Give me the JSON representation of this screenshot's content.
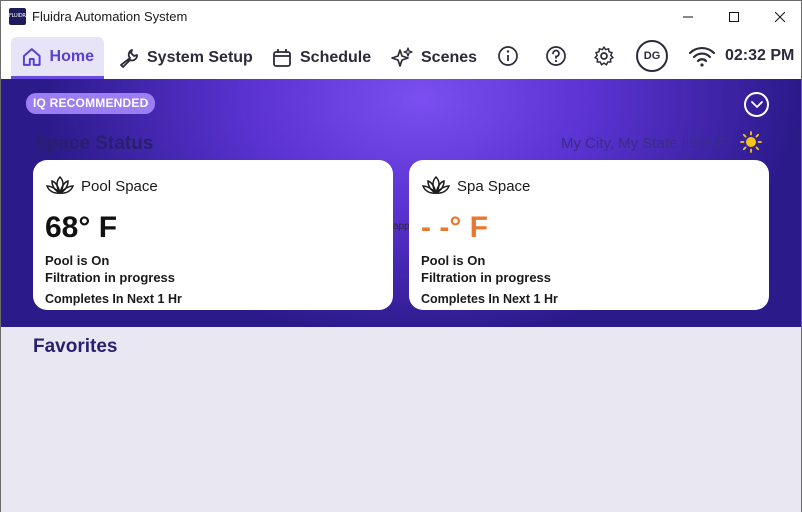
{
  "window": {
    "logo_text": "FLUIDRA",
    "title": "Fluidra Automation System"
  },
  "nav": {
    "tabs": [
      {
        "label": "Home",
        "icon": "home-icon",
        "active": true
      },
      {
        "label": "System Setup",
        "icon": "wrench-icon",
        "active": false
      },
      {
        "label": "Schedule",
        "icon": "calendar-icon",
        "active": false
      },
      {
        "label": "Scenes",
        "icon": "sparkle-icon",
        "active": false
      }
    ],
    "icons": [
      "info-icon",
      "help-icon",
      "gear-icon",
      "wifi-icon"
    ],
    "avatar_initials": "DG",
    "time": "02:32 PM"
  },
  "hero": {
    "badge": "IQ RECOMMENDED",
    "section_title": "Space Status",
    "weather": "My City, My State | 56° F",
    "peek_text": "app",
    "cards": [
      {
        "name": "Pool Space",
        "temperature": "68° F",
        "status": "Pool is On",
        "activity": "Filtration in progress",
        "completion": "Completes In Next 1 Hr"
      },
      {
        "name": "Spa Space",
        "temperature": "- -° F",
        "status": "Pool is On",
        "activity": "Filtration in progress",
        "completion": "Completes In Next 1 Hr"
      }
    ]
  },
  "favorites": {
    "title": "Favorites"
  },
  "colors": {
    "accent": "#6a4be0",
    "hero_dark": "#2b1a8a",
    "hero_light": "#7b4ff0",
    "spa_temp": "#e8782e",
    "badge": "#9d7ef2"
  }
}
